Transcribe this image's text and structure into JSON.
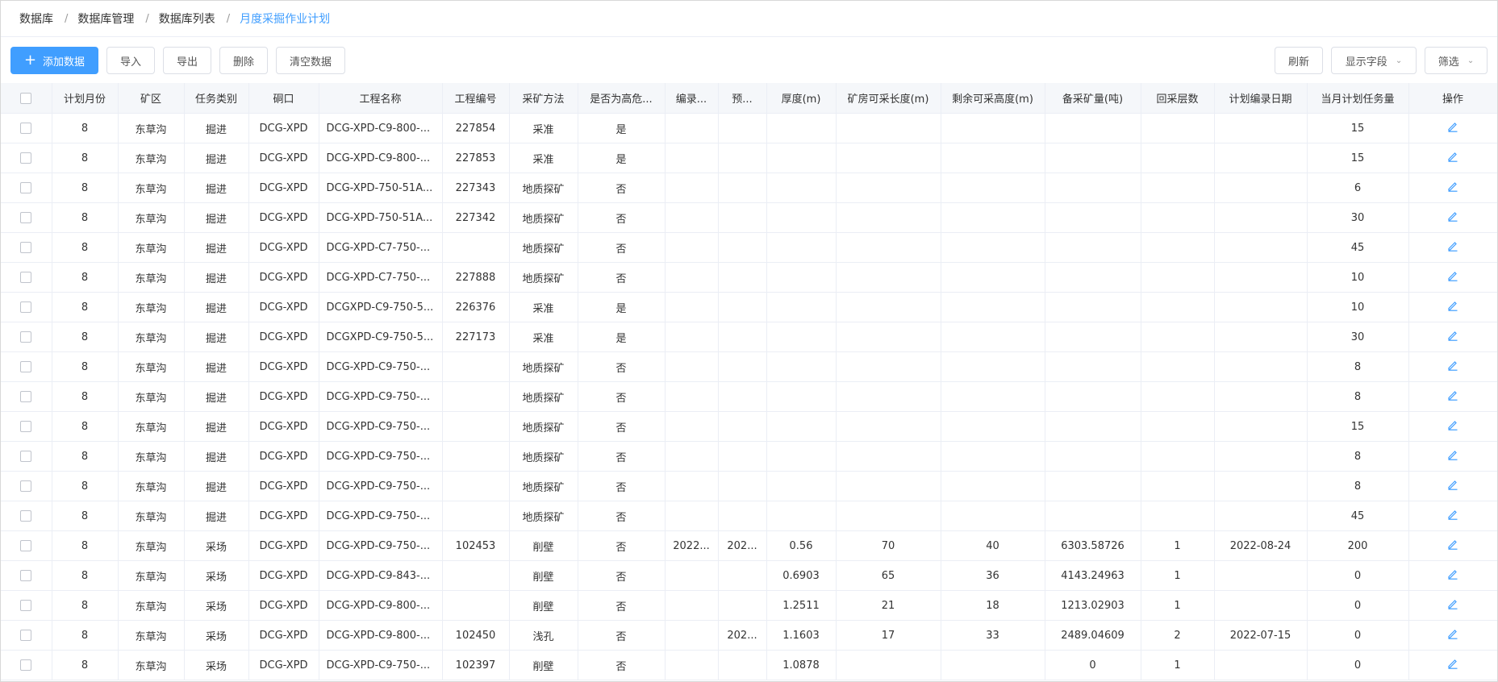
{
  "breadcrumb": {
    "items": [
      "数据库",
      "数据库管理",
      "数据库列表"
    ],
    "current": "月度采掘作业计划",
    "separator": "/"
  },
  "toolbar": {
    "add_label": "添加数据",
    "import_label": "导入",
    "export_label": "导出",
    "delete_label": "删除",
    "clear_label": "清空数据",
    "refresh_label": "刷新",
    "fields_label": "显示字段",
    "filter_label": "筛选"
  },
  "colors": {
    "primary": "#409eff",
    "header_bg": "#f5f7fa",
    "border": "#ebeef5"
  },
  "table": {
    "headers": [
      "计划月份",
      "矿区",
      "任务类别",
      "硐口",
      "工程名称",
      "工程编号",
      "采矿方法",
      "是否为高危...",
      "编录...",
      "预...",
      "厚度(m)",
      "矿房可采长度(m)",
      "剩余可采高度(m)",
      "备采矿量(吨)",
      "回采层数",
      "计划编录日期",
      "当月计划任务量",
      "操作"
    ],
    "rows": [
      [
        "8",
        "东草沟",
        "掘进",
        "DCG-XPD",
        "DCG-XPD-C9-800-...",
        "227854",
        "采准",
        "是",
        "",
        "",
        "",
        "",
        "",
        "",
        "",
        "",
        "15"
      ],
      [
        "8",
        "东草沟",
        "掘进",
        "DCG-XPD",
        "DCG-XPD-C9-800-...",
        "227853",
        "采准",
        "是",
        "",
        "",
        "",
        "",
        "",
        "",
        "",
        "",
        "15"
      ],
      [
        "8",
        "东草沟",
        "掘进",
        "DCG-XPD",
        "DCG-XPD-750-51A...",
        "227343",
        "地质探矿",
        "否",
        "",
        "",
        "",
        "",
        "",
        "",
        "",
        "",
        "6"
      ],
      [
        "8",
        "东草沟",
        "掘进",
        "DCG-XPD",
        "DCG-XPD-750-51A...",
        "227342",
        "地质探矿",
        "否",
        "",
        "",
        "",
        "",
        "",
        "",
        "",
        "",
        "30"
      ],
      [
        "8",
        "东草沟",
        "掘进",
        "DCG-XPD",
        "DCG-XPD-C7-750-...",
        "",
        "地质探矿",
        "否",
        "",
        "",
        "",
        "",
        "",
        "",
        "",
        "",
        "45"
      ],
      [
        "8",
        "东草沟",
        "掘进",
        "DCG-XPD",
        "DCG-XPD-C7-750-...",
        "227888",
        "地质探矿",
        "否",
        "",
        "",
        "",
        "",
        "",
        "",
        "",
        "",
        "10"
      ],
      [
        "8",
        "东草沟",
        "掘进",
        "DCG-XPD",
        "DCGXPD-C9-750-5...",
        "226376",
        "采准",
        "是",
        "",
        "",
        "",
        "",
        "",
        "",
        "",
        "",
        "10"
      ],
      [
        "8",
        "东草沟",
        "掘进",
        "DCG-XPD",
        "DCGXPD-C9-750-5...",
        "227173",
        "采准",
        "是",
        "",
        "",
        "",
        "",
        "",
        "",
        "",
        "",
        "30"
      ],
      [
        "8",
        "东草沟",
        "掘进",
        "DCG-XPD",
        "DCG-XPD-C9-750-...",
        "",
        "地质探矿",
        "否",
        "",
        "",
        "",
        "",
        "",
        "",
        "",
        "",
        "8"
      ],
      [
        "8",
        "东草沟",
        "掘进",
        "DCG-XPD",
        "DCG-XPD-C9-750-...",
        "",
        "地质探矿",
        "否",
        "",
        "",
        "",
        "",
        "",
        "",
        "",
        "",
        "8"
      ],
      [
        "8",
        "东草沟",
        "掘进",
        "DCG-XPD",
        "DCG-XPD-C9-750-...",
        "",
        "地质探矿",
        "否",
        "",
        "",
        "",
        "",
        "",
        "",
        "",
        "",
        "15"
      ],
      [
        "8",
        "东草沟",
        "掘进",
        "DCG-XPD",
        "DCG-XPD-C9-750-...",
        "",
        "地质探矿",
        "否",
        "",
        "",
        "",
        "",
        "",
        "",
        "",
        "",
        "8"
      ],
      [
        "8",
        "东草沟",
        "掘进",
        "DCG-XPD",
        "DCG-XPD-C9-750-...",
        "",
        "地质探矿",
        "否",
        "",
        "",
        "",
        "",
        "",
        "",
        "",
        "",
        "8"
      ],
      [
        "8",
        "东草沟",
        "掘进",
        "DCG-XPD",
        "DCG-XPD-C9-750-...",
        "",
        "地质探矿",
        "否",
        "",
        "",
        "",
        "",
        "",
        "",
        "",
        "",
        "45"
      ],
      [
        "8",
        "东草沟",
        "采场",
        "DCG-XPD",
        "DCG-XPD-C9-750-...",
        "102453",
        "削壁",
        "否",
        "2022...",
        "202...",
        "0.56",
        "70",
        "40",
        "6303.58726",
        "1",
        "2022-08-24",
        "200"
      ],
      [
        "8",
        "东草沟",
        "采场",
        "DCG-XPD",
        "DCG-XPD-C9-843-...",
        "",
        "削壁",
        "否",
        "",
        "",
        "0.6903",
        "65",
        "36",
        "4143.24963",
        "1",
        "",
        "0"
      ],
      [
        "8",
        "东草沟",
        "采场",
        "DCG-XPD",
        "DCG-XPD-C9-800-...",
        "",
        "削壁",
        "否",
        "",
        "",
        "1.2511",
        "21",
        "18",
        "1213.02903",
        "1",
        "",
        "0"
      ],
      [
        "8",
        "东草沟",
        "采场",
        "DCG-XPD",
        "DCG-XPD-C9-800-...",
        "102450",
        "浅孔",
        "否",
        "",
        "202...",
        "1.1603",
        "17",
        "33",
        "2489.04609",
        "2",
        "2022-07-15",
        "0"
      ],
      [
        "8",
        "东草沟",
        "采场",
        "DCG-XPD",
        "DCG-XPD-C9-750-...",
        "102397",
        "削壁",
        "否",
        "",
        "",
        "1.0878",
        "",
        "",
        "0",
        "1",
        "",
        "0"
      ]
    ]
  }
}
